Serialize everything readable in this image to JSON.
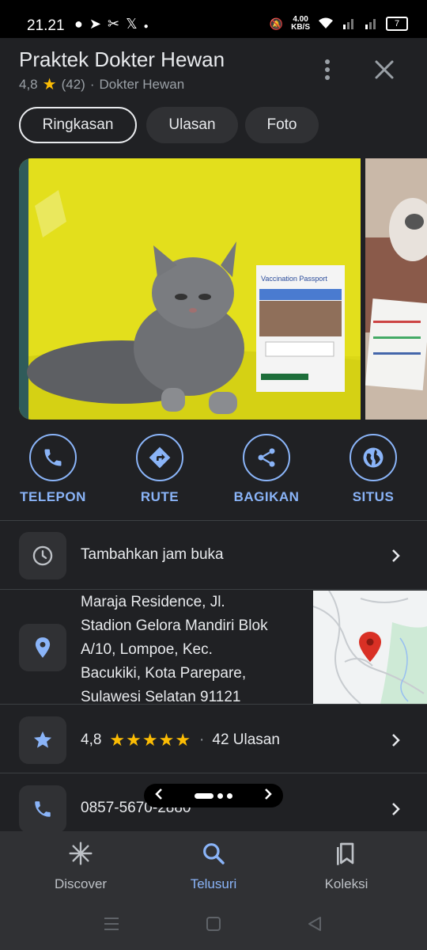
{
  "status_bar": {
    "time": "21.21",
    "notif_icons": [
      "spotify-icon",
      "telegram-icon",
      "capcut-icon",
      "x-icon",
      "dot-icon"
    ],
    "net_speed_value": "4.00",
    "net_speed_unit": "KB/S",
    "battery": "7"
  },
  "place": {
    "title": "Praktek Dokter Hewan",
    "rating": "4,8",
    "review_count": "(42)",
    "separator": "·",
    "category": "Dokter Hewan"
  },
  "tabs": [
    {
      "label": "Ringkasan",
      "active": true
    },
    {
      "label": "Ulasan",
      "active": false
    },
    {
      "label": "Foto",
      "active": false
    }
  ],
  "photo": {
    "passport_title": "Vaccination Passport"
  },
  "actions": [
    {
      "label": "TELEPON",
      "icon": "phone-icon"
    },
    {
      "label": "RUTE",
      "icon": "directions-icon"
    },
    {
      "label": "BAGIKAN",
      "icon": "share-icon"
    },
    {
      "label": "SITUS",
      "icon": "globe-icon"
    }
  ],
  "info": {
    "hours": "Tambahkan jam buka",
    "address_lines": [
      "Maraja Residence, Jl.",
      "Stadion Gelora Mandiri Blok",
      "A/10, Lompoe, Kec.",
      "Bacukiki, Kota Parepare,",
      "Sulawesi Selatan 91121"
    ],
    "rating_value": "4,8",
    "rating_stars": "★★★★★",
    "rating_sep": "·",
    "reviews": "42 Ulasan",
    "phone": "0857-5670-2880"
  },
  "bottom_nav": [
    {
      "label": "Discover",
      "icon": "discover-icon",
      "active": false
    },
    {
      "label": "Telusuri",
      "icon": "search-icon",
      "active": true
    },
    {
      "label": "Koleksi",
      "icon": "bookmarks-icon",
      "active": false
    }
  ],
  "colors": {
    "background": "#202124",
    "accent": "#8ab4f8",
    "star": "#fbbc04",
    "map_pin": "#d93025"
  }
}
